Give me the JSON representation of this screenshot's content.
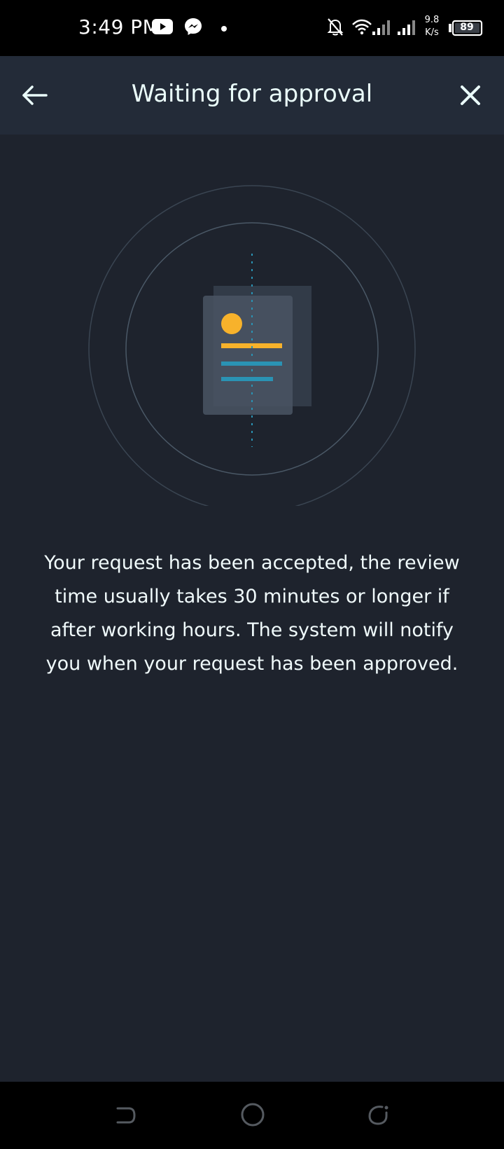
{
  "status_bar": {
    "time": "3:49 PM",
    "speed_value": "9.8",
    "speed_unit": "K/s",
    "battery": "89",
    "icons": [
      "youtube-icon",
      "messenger-icon",
      "notification-dot-icon",
      "bell-off-icon",
      "wifi-icon",
      "signal-icon",
      "signal-icon",
      "battery-icon"
    ]
  },
  "app_bar": {
    "title": "Waiting for approval",
    "back_icon": "arrow-left-icon",
    "close_icon": "close-icon"
  },
  "main": {
    "illustration": "document-review-icon",
    "message": "Your request has been accepted, the review time usually takes 30 minutes or longer if after working hours. The system will notify you when your request has been approved."
  },
  "nav_bar": {
    "icons": [
      "nav-back-icon",
      "nav-home-icon",
      "nav-recent-icon"
    ]
  },
  "colors": {
    "background": "#1e232d",
    "app_bar": "#232b38",
    "accent_yellow": "#f7b22b",
    "accent_teal": "#2a93b4",
    "text": "#eafcfa"
  }
}
